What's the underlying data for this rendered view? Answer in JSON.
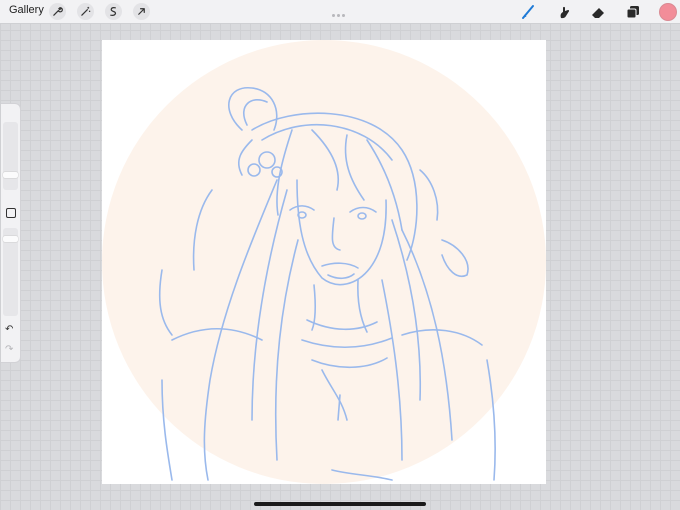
{
  "topbar": {
    "gallery_label": "Gallery",
    "left_tools": [
      "wrench-icon",
      "magic-wand-icon",
      "selection-icon",
      "transform-arrow-icon"
    ],
    "right_tools": [
      "brush-icon",
      "smudge-icon",
      "eraser-icon",
      "layers-icon"
    ],
    "active_tool": "brush-icon",
    "accent_color": "#1e7ad6",
    "current_color": "#f28d99"
  },
  "sidebar": {
    "brush_size_level": 0.2,
    "opacity_level": 0.9,
    "undo_icon": "↶",
    "redo_icon": "↷"
  },
  "canvas": {
    "background": "#ffffff",
    "circle_fill": "#fdf3eb",
    "sketch_color": "#9ab9ec"
  }
}
